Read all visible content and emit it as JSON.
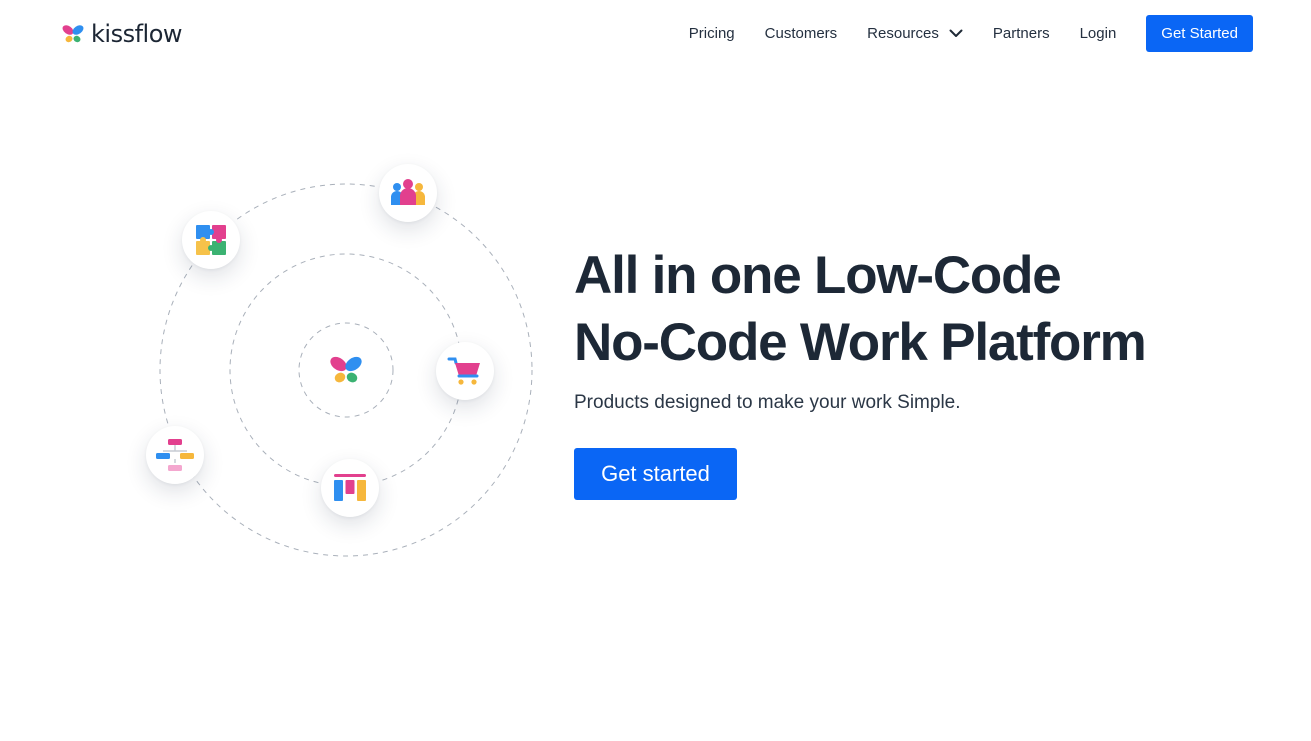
{
  "brand": {
    "name": "kissflow",
    "colors": {
      "primary": "#0a66f5",
      "heading": "#1d2836",
      "petal_pink": "#e2408e",
      "petal_blue": "#2f8ff0",
      "petal_yellow": "#f6b73c",
      "petal_green": "#3bb272"
    }
  },
  "nav": {
    "items": [
      {
        "label": "Pricing"
      },
      {
        "label": "Customers"
      },
      {
        "label": "Resources",
        "icon": "chevron-down-icon"
      },
      {
        "label": "Partners"
      },
      {
        "label": "Login"
      }
    ],
    "cta_label": "Get Started"
  },
  "hero": {
    "title_line1": "All in one Low-Code",
    "title_line2": "No-Code Work Platform",
    "subtitle": "Products designed to make your work Simple.",
    "cta_label": "Get started"
  },
  "orbit": {
    "center_icon": "kissflow-butterfly-icon",
    "satellites": [
      {
        "icon": "puzzle-icon"
      },
      {
        "icon": "people-icon"
      },
      {
        "icon": "cart-icon"
      },
      {
        "icon": "kanban-board-icon"
      },
      {
        "icon": "flowchart-icon"
      }
    ]
  }
}
